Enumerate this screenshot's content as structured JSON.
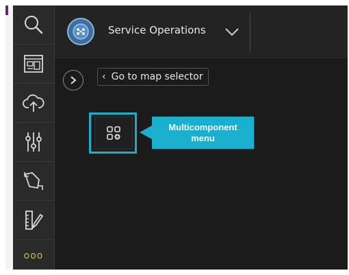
{
  "header": {
    "app_title": "Service Operations",
    "logo_icon": "service-operations-logo-icon",
    "dropdown_icon": "chevron-down-icon"
  },
  "sidebar": {
    "items": [
      {
        "icon": "search-icon"
      },
      {
        "icon": "map-layout-icon"
      },
      {
        "icon": "cloud-upload-icon"
      },
      {
        "icon": "sliders-icon"
      },
      {
        "icon": "transform-icon"
      },
      {
        "icon": "ruler-pencil-icon"
      }
    ],
    "more_label": "ooo"
  },
  "navigation": {
    "expand_icon": "chevron-right-icon",
    "goto_map_selector_label": "Go to map selector",
    "goto_chevron": "‹"
  },
  "multicomponent": {
    "icon": "multicomponent-grid-add-icon",
    "callout_label": "Multicomponent menu"
  },
  "colors": {
    "highlight": "#1aafcf",
    "background": "#1b1b1b",
    "sidebar": "#2a2a2a"
  }
}
